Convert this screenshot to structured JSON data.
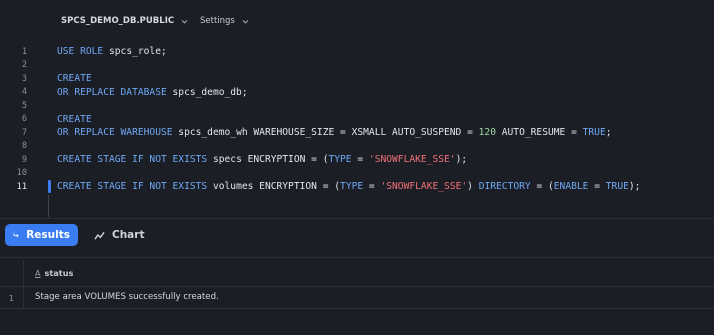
{
  "topbar": {
    "database_context": "SPCS_DEMO_DB.PUBLIC",
    "settings_label": "Settings"
  },
  "editor": {
    "line_numbers": [
      "1",
      "2",
      "3",
      "4",
      "5",
      "6",
      "7",
      "8",
      "9",
      "10",
      "11"
    ],
    "active_line": "11",
    "lines": {
      "l1": {
        "kw1": "USE ROLE",
        "rest": " spcs_role;"
      },
      "l3": {
        "kw1": "CREATE"
      },
      "l4": {
        "kw1": "OR REPLACE DATABASE",
        "rest": " spcs_demo_db;"
      },
      "l6": {
        "kw1": "CREATE"
      },
      "l7": {
        "kw1": "OR REPLACE WAREHOUSE",
        "rest1": " spcs_demo_wh WAREHOUSE_SIZE = XSMALL AUTO_SUSPEND = ",
        "num": "120",
        "rest2": " AUTO_RESUME = ",
        "kw2": "TRUE",
        "rest3": ";"
      },
      "l9": {
        "kw1": "CREATE STAGE IF NOT EXISTS",
        "rest1": " specs ENCRYPTION = (",
        "kw2": "TYPE",
        "rest2": " = ",
        "str": "'SNOWFLAKE_SSE'",
        "rest3": ");"
      },
      "l11": {
        "kw1": "CREATE STAGE IF NOT EXISTS",
        "rest1": " volumes ENCRYPTION = (",
        "kw2": "TYPE",
        "rest2": " = ",
        "str": "'SNOWFLAKE_SSE'",
        "rest3": ") ",
        "kw3": "DIRECTORY",
        "rest4": " = (",
        "kw4": "ENABLE",
        "rest5": " = ",
        "kw5": "TRUE",
        "rest6": ");"
      }
    }
  },
  "tabs": {
    "results_label": "Results",
    "chart_label": "Chart",
    "results_icon": "return-arrow-icon",
    "chart_icon": "line-chart-icon"
  },
  "results": {
    "column_type_glyph": "A",
    "column_header": "status",
    "rows": [
      {
        "index": "1",
        "status": "Stage area VOLUMES successfully created."
      }
    ]
  },
  "colors": {
    "background": "#1b1e24",
    "accent": "#3a7df2",
    "keyword": "#6fa8f5",
    "string": "#f2707a",
    "number": "#9fd7a0"
  }
}
